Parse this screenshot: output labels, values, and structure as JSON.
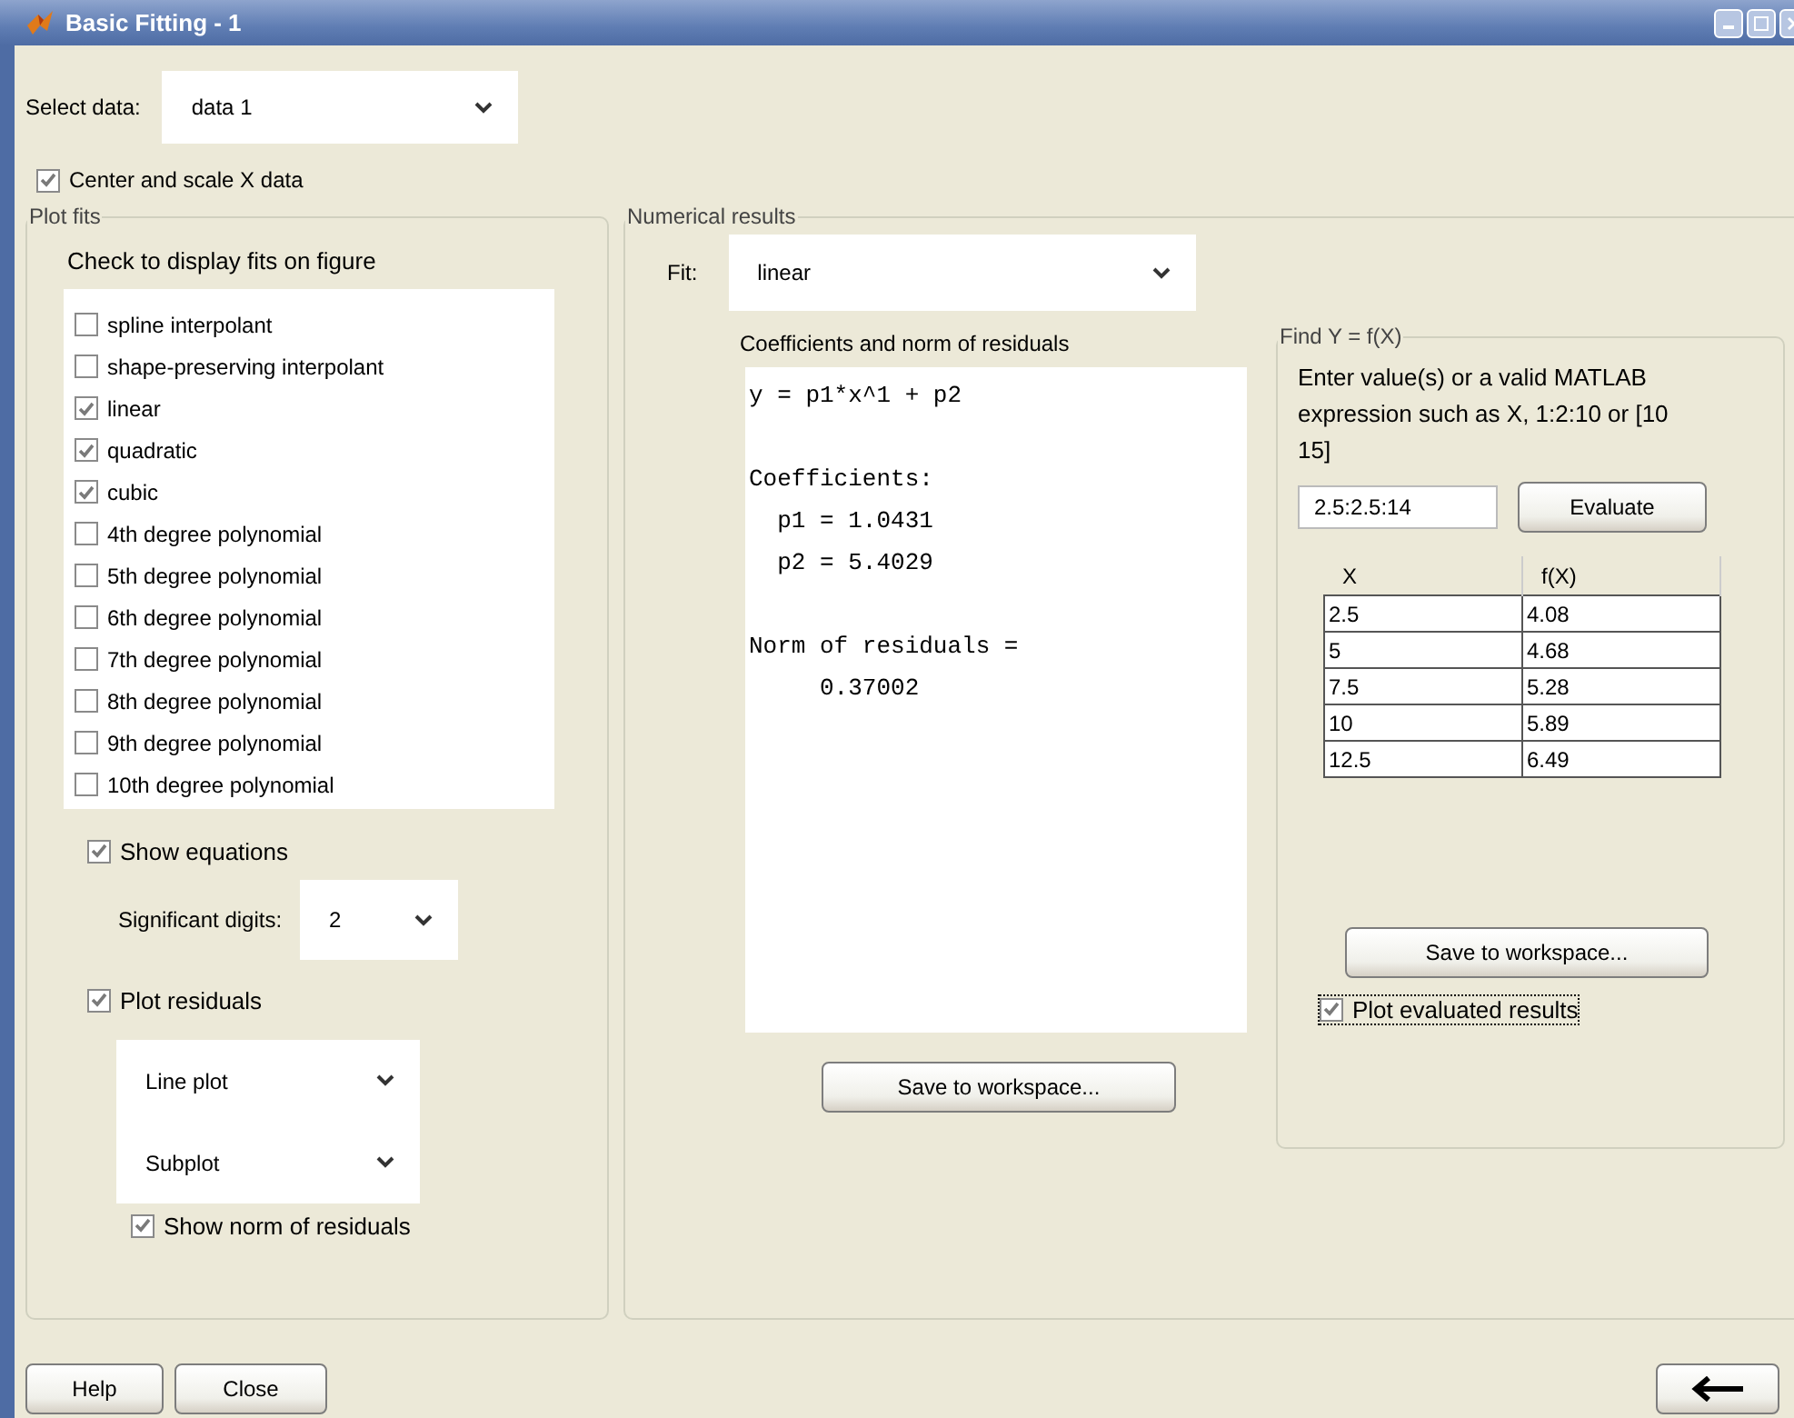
{
  "window": {
    "title": "Basic Fitting - 1"
  },
  "select_data": {
    "label": "Select data:",
    "value": "data 1"
  },
  "center_scale": {
    "label": "Center and scale X data",
    "checked": true
  },
  "plot_fits": {
    "title": "Plot fits",
    "caption": "Check to display fits on figure",
    "fits": [
      {
        "label": "spline interpolant",
        "checked": false
      },
      {
        "label": "shape-preserving interpolant",
        "checked": false
      },
      {
        "label": "linear",
        "checked": true
      },
      {
        "label": "quadratic",
        "checked": true
      },
      {
        "label": "cubic",
        "checked": true
      },
      {
        "label": "4th degree polynomial",
        "checked": false
      },
      {
        "label": "5th degree polynomial",
        "checked": false
      },
      {
        "label": "6th degree polynomial",
        "checked": false
      },
      {
        "label": "7th degree polynomial",
        "checked": false
      },
      {
        "label": "8th degree polynomial",
        "checked": false
      },
      {
        "label": "9th degree polynomial",
        "checked": false
      },
      {
        "label": "10th degree polynomial",
        "checked": false
      }
    ],
    "show_equations": {
      "label": "Show equations",
      "checked": true
    },
    "significant_digits": {
      "label": "Significant digits:",
      "value": "2"
    },
    "plot_residuals": {
      "label": "Plot residuals",
      "checked": true
    },
    "residual_plot_type": "Line plot",
    "residual_plot_location": "Subplot",
    "show_norm": {
      "label": "Show norm of residuals",
      "checked": true
    }
  },
  "numerical_results": {
    "title": "Numerical results",
    "fit_label": "Fit:",
    "fit_value": "linear",
    "caption": "Coefficients and norm of residuals",
    "paragraphs": [
      [
        "y = p1*x^1 + p2"
      ],
      [
        "Coefficients:",
        "  p1 = 1.0431",
        "  p2 = 5.4029"
      ],
      [
        "Norm of residuals =",
        "     0.37002"
      ]
    ],
    "save_button": "Save to workspace..."
  },
  "find_y": {
    "title": "Find Y = f(X)",
    "instructions": "Enter value(s) or a valid MATLAB expression such as X, 1:2:10 or [10 15]",
    "input": "2.5:2.5:14",
    "evaluate_button": "Evaluate",
    "table": {
      "columns": [
        "X",
        "f(X)"
      ],
      "rows": [
        [
          "2.5",
          "4.08"
        ],
        [
          "5",
          "4.68"
        ],
        [
          "7.5",
          "5.28"
        ],
        [
          "10",
          "5.89"
        ],
        [
          "12.5",
          "6.49"
        ]
      ]
    },
    "save_button": "Save to workspace...",
    "plot_evaluated": {
      "label": "Plot evaluated results",
      "checked": true,
      "focused": true
    }
  },
  "buttons": {
    "help": "Help",
    "close": "Close"
  }
}
